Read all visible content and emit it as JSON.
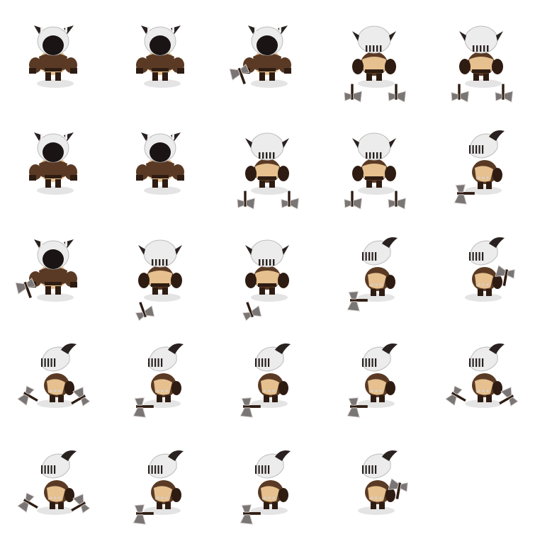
{
  "sprite_sheet": {
    "grid": {
      "columns": 5,
      "rows": 5
    },
    "background": "#ffffff",
    "colors": {
      "helmet": "#ececec",
      "helmet_shade": "#bdbdbd",
      "visor_dark": "#1a1414",
      "stripe_dark": "#2a2220",
      "armor": "#5a3a24",
      "armor_dark": "#2e1c12",
      "skin": "#e6c08e",
      "blade": "#7a7676",
      "blade_edge": "#d8d0cc",
      "shadow": "#d8d8d8"
    },
    "frames": [
      {
        "pose": "front-facing-idle",
        "facing": "front",
        "weapon": "none-visible"
      },
      {
        "pose": "front-facing-idle",
        "facing": "front",
        "weapon": "none-visible"
      },
      {
        "pose": "front-facing-idle",
        "facing": "front",
        "weapon": "axe-low"
      },
      {
        "pose": "back-facing-walk",
        "facing": "back",
        "weapon": "axes-lowered"
      },
      {
        "pose": "back-facing-walk",
        "facing": "back",
        "weapon": "axes-lowered"
      },
      {
        "pose": "front-facing-idle",
        "facing": "front",
        "weapon": "none-visible"
      },
      {
        "pose": "front-facing-idle",
        "facing": "front",
        "weapon": "none-visible"
      },
      {
        "pose": "back-facing-stand",
        "facing": "back",
        "weapon": "axes-lowered"
      },
      {
        "pose": "back-facing-stand",
        "facing": "back",
        "weapon": "axes-lowered"
      },
      {
        "pose": "side-facing-swing",
        "facing": "side",
        "weapon": "axe-forward"
      },
      {
        "pose": "front-facing-idle",
        "facing": "front",
        "weapon": "axe-low"
      },
      {
        "pose": "back-facing-turn",
        "facing": "back",
        "weapon": "axe-low"
      },
      {
        "pose": "back-facing-turn",
        "facing": "back",
        "weapon": "axe-low"
      },
      {
        "pose": "side-facing-attack",
        "facing": "side",
        "weapon": "axe-ground"
      },
      {
        "pose": "side-facing-turn",
        "facing": "side",
        "weapon": "axe-raised"
      },
      {
        "pose": "side-facing-crouch",
        "facing": "side",
        "weapon": "axes-spread"
      },
      {
        "pose": "side-facing-attack",
        "facing": "side",
        "weapon": "axe-ground"
      },
      {
        "pose": "side-facing-attack",
        "facing": "side",
        "weapon": "axe-ground"
      },
      {
        "pose": "side-facing-attack",
        "facing": "side",
        "weapon": "axe-ground"
      },
      {
        "pose": "side-facing-crouch",
        "facing": "side",
        "weapon": "axes-spread"
      },
      {
        "pose": "side-facing-crouch",
        "facing": "side",
        "weapon": "axes-spread"
      },
      {
        "pose": "side-facing-lunge",
        "facing": "side",
        "weapon": "axe-forward"
      },
      {
        "pose": "side-facing-lunge",
        "facing": "side",
        "weapon": "axe-ground"
      },
      {
        "pose": "side-facing-lunge",
        "facing": "side",
        "weapon": "axe-raised"
      },
      {
        "pose": "empty",
        "facing": "none",
        "weapon": "none"
      }
    ]
  }
}
